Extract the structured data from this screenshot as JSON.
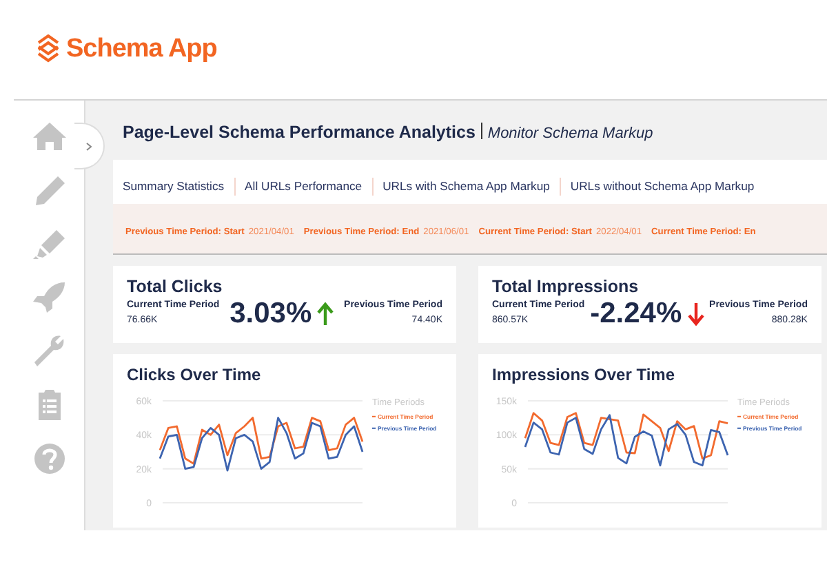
{
  "logo": {
    "text": "Schema App"
  },
  "sidebar": {
    "items": [
      {
        "kind": "home"
      },
      {
        "kind": "pencil"
      },
      {
        "kind": "marker"
      },
      {
        "kind": "rocket"
      },
      {
        "kind": "wrench"
      },
      {
        "kind": "clipboard"
      },
      {
        "kind": "help"
      }
    ]
  },
  "page": {
    "title": "Page-Level Schema Performance Analytics",
    "subtitle": "Monitor Schema Markup"
  },
  "tabs": [
    {
      "label": "Summary Statistics"
    },
    {
      "label": "All URLs Performance"
    },
    {
      "label": "URLs with Schema App Markup"
    },
    {
      "label": "URLs without Schema App Markup"
    }
  ],
  "filters": [
    {
      "label": "Previous Time Period: Start",
      "value": "2021/04/01"
    },
    {
      "label": "Previous Time Period: End",
      "value": "2021/06/01"
    },
    {
      "label": "Current Time Period: Start",
      "value": "2022/04/01"
    },
    {
      "label": "Current Time Period: En"
    }
  ],
  "kpis": [
    {
      "title": "Total Clicks",
      "current_label": "Current Time Period",
      "current_value": "76.66K",
      "change": "3.03%",
      "increase": true,
      "previous_label": "Previous Time Period",
      "previous_value": "74.40K"
    },
    {
      "title": "Total Impressions",
      "current_label": "Current Time Period",
      "current_value": "860.57K",
      "change": "-2.24%",
      "increase": false,
      "previous_label": "Previous Time Period",
      "previous_value": "880.28K"
    }
  ],
  "charts": [
    {
      "title": "Clicks Over Time",
      "chart_data": {
        "type": "line",
        "legend": "right",
        "legend_title": "Time Periods",
        "ylim": [
          0,
          60000
        ],
        "yticks": [
          {
            "value": 0,
            "label": "0"
          },
          {
            "value": 20000,
            "label": "20k"
          },
          {
            "value": 40000,
            "label": "40k"
          },
          {
            "value": 60000,
            "label": "60k"
          }
        ],
        "series": [
          {
            "name": "Current Time Period",
            "color": "#f26a2e",
            "values": [
              31000,
              44000,
              45000,
              26000,
              23000,
              43000,
              40000,
              46000,
              28000,
              41000,
              45000,
              50000,
              26000,
              27000,
              45000,
              47000,
              32000,
              33000,
              50000,
              48000,
              31000,
              32000,
              46000,
              50000,
              36000
            ]
          },
          {
            "name": "Previous Time Period",
            "color": "#3d64b0",
            "values": [
              26000,
              39000,
              40000,
              20000,
              21000,
              38000,
              44000,
              40000,
              19000,
              38000,
              40000,
              36000,
              20000,
              24000,
              50000,
              41000,
              26000,
              29000,
              47000,
              45000,
              26000,
              27000,
              40000,
              45000,
              30000
            ]
          }
        ]
      }
    },
    {
      "title": "Impressions Over Time",
      "chart_data": {
        "type": "line",
        "legend": "right",
        "legend_title": "Time Periods",
        "ylim": [
          0,
          150000
        ],
        "yticks": [
          {
            "value": 0,
            "label": "0"
          },
          {
            "value": 50000,
            "label": "50k"
          },
          {
            "value": 100000,
            "label": "100k"
          },
          {
            "value": 150000,
            "label": "150k"
          }
        ],
        "series": [
          {
            "name": "Current Time Period",
            "color": "#f26a2e",
            "values": [
              95000,
              132000,
              121000,
              88000,
              85000,
              126000,
              132000,
              88000,
              85000,
              125000,
              123000,
              121000,
              74000,
              73000,
              130000,
              120000,
              110000,
              76000,
              120000,
              108000,
              113000,
              65000,
              70000,
              120000,
              117000
            ]
          },
          {
            "name": "Previous Time Period",
            "color": "#3d64b0",
            "values": [
              82000,
              118000,
              108000,
              74000,
              71000,
              118000,
              125000,
              79000,
              72000,
              108000,
              129000,
              66000,
              58000,
              97000,
              105000,
              99000,
              55000,
              108000,
              116000,
              100000,
              60000,
              55000,
              107000,
              104000,
              70000
            ]
          }
        ]
      }
    }
  ]
}
